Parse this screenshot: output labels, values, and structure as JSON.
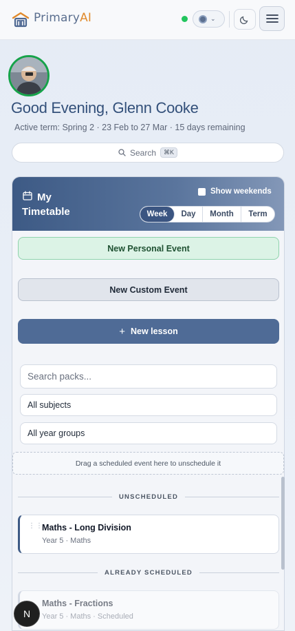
{
  "header": {
    "brand_primary": "Primary",
    "brand_ai": "AI",
    "status": "online",
    "icons": [
      "home-logo-icon",
      "globe-icon",
      "chevron-down-icon",
      "moon-icon",
      "menu-icon"
    ]
  },
  "greeting": {
    "title": "Good Evening, Glenn Cooke",
    "term": "Active term: Spring 2 · 23 Feb to 27 Mar · 15 days remaining"
  },
  "search": {
    "label": "Search",
    "shortcut": "⌘K"
  },
  "timetable": {
    "title": "My Timetable",
    "show_weekends_label": "Show weekends",
    "show_weekends_checked": false,
    "views": [
      "Week",
      "Day",
      "Month",
      "Term"
    ],
    "active_view": "Week",
    "new_personal_event": "New Personal Event",
    "new_custom_event": "New Custom Event",
    "new_lesson": "New lesson",
    "search_packs_placeholder": "Search packs...",
    "subject_filter": "All subjects",
    "year_filter": "All year groups",
    "dropzone_text": "Drag a scheduled event here to unschedule it",
    "unscheduled_heading": "UNSCHEDULED",
    "scheduled_heading": "ALREADY SCHEDULED",
    "unscheduled": [
      {
        "title": "Maths - Long Division",
        "sub": "Year 5 · Maths"
      }
    ],
    "scheduled": [
      {
        "title": "Maths - Fractions",
        "sub": "Year 5 · Maths · Scheduled"
      }
    ]
  },
  "badge": {
    "label": "N"
  },
  "colors": {
    "accent": "#3d5a85",
    "brand_ai": "#e08a2c",
    "personal_event": "#dcf3e6",
    "online": "#22c55e"
  }
}
